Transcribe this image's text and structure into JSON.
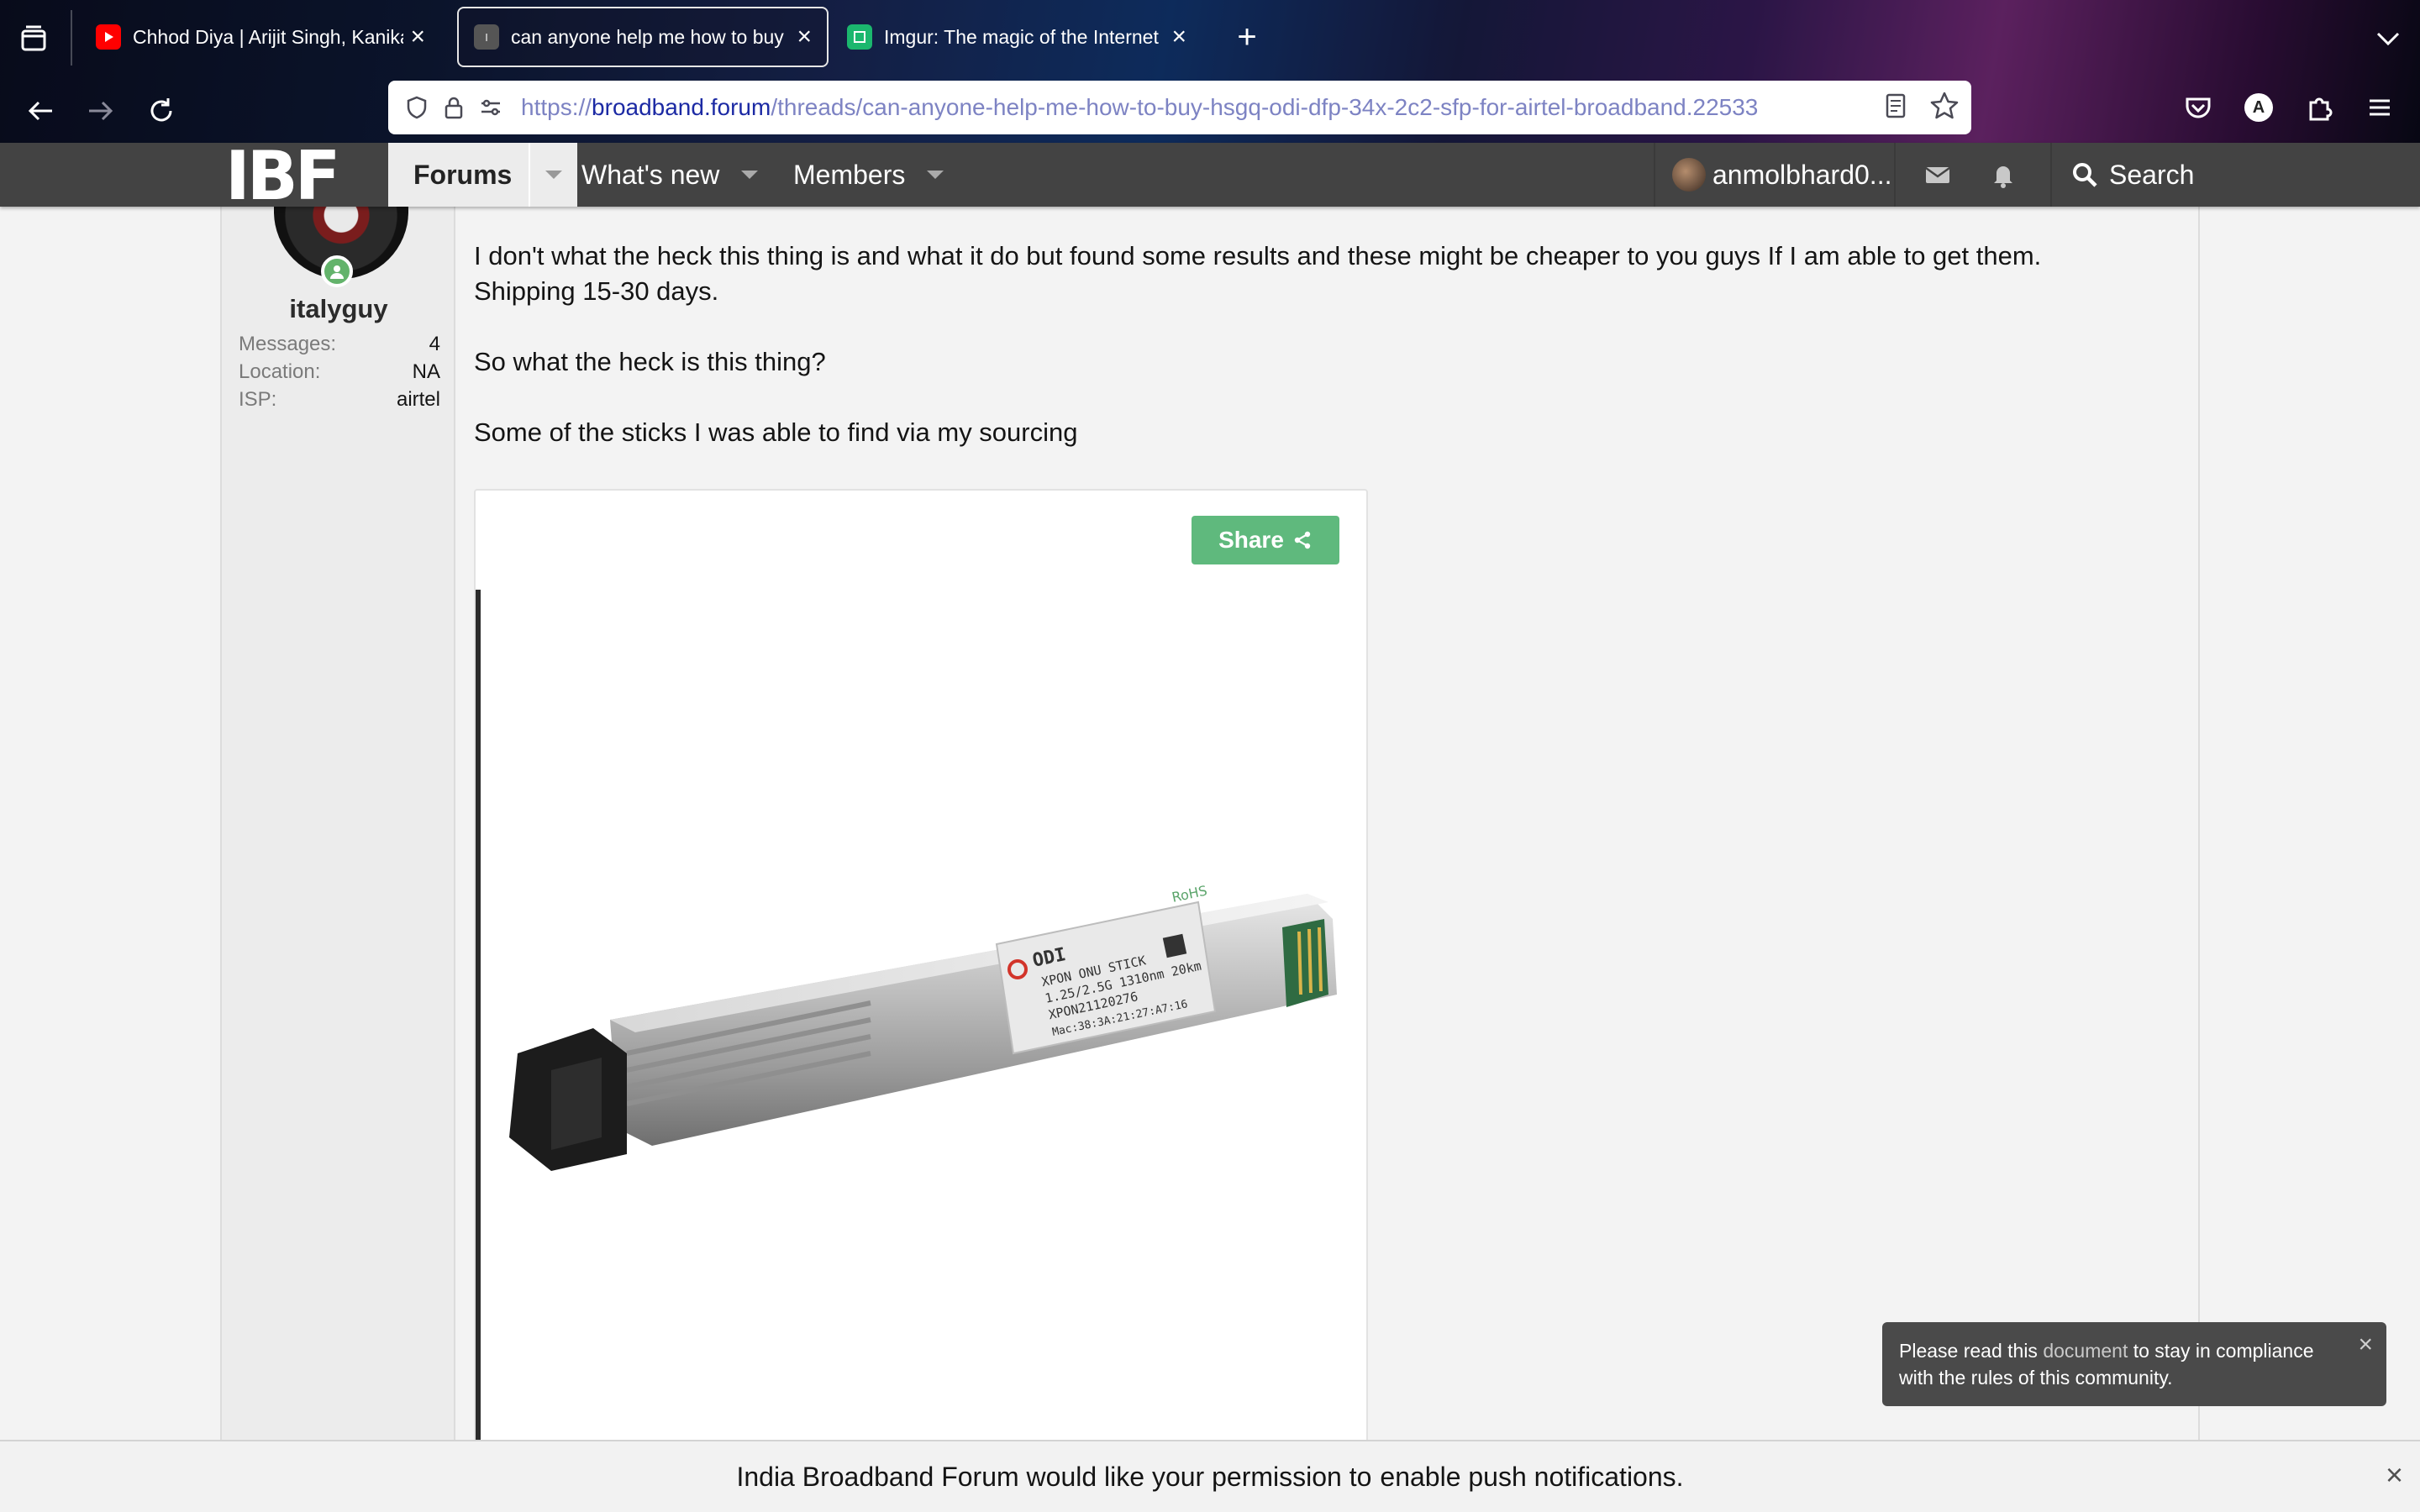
{
  "browser": {
    "tabs": [
      {
        "title": "Chhod Diya | Arijit Singh, Kanika",
        "favicon": "youtube-icon",
        "active": false
      },
      {
        "title": "can anyone help me how to buy",
        "favicon": "ibf-favicon",
        "active": true
      },
      {
        "title": "Imgur: The magic of the Internet",
        "favicon": "imgur-icon",
        "active": false
      }
    ],
    "new_tab": "+",
    "url_scheme": "https://",
    "url_host": "broadband.forum",
    "url_path": "/threads/can-anyone-help-me-how-to-buy-hsgq-odi-dfp-34x-2c2-sfp-for-airtel-broadband.22533",
    "profile_initial": "A"
  },
  "site": {
    "logo": "IBF",
    "nav": [
      {
        "label": "Forums",
        "selected": true
      },
      {
        "label": "What's new",
        "selected": false
      },
      {
        "label": "Members",
        "selected": false
      }
    ],
    "user": "anmolbhard0...",
    "search_label": "Search"
  },
  "post": {
    "author": "italyguy",
    "stats": [
      {
        "key": "Messages:",
        "value": "4"
      },
      {
        "key": "Location:",
        "value": "NA"
      },
      {
        "key": "ISP:",
        "value": "airtel"
      }
    ],
    "paragraphs": [
      "I don't what the heck this thing is and what it do but found some results and these might be cheaper to you guys If I am able to get them.",
      "Shipping 15-30 days.",
      "So what the heck is this thing?",
      "Some of the sticks I was able to find via my sourcing"
    ],
    "share_label": "Share",
    "product_label": {
      "brand": "ODI",
      "line1": "XPON ONU STICK",
      "line2": "1.25/2.5G 1310nm 20km",
      "line3": "XPON21120276",
      "line4": "Mac:38:3A:21:27:A7:16",
      "rohs": "RoHS"
    }
  },
  "toast": {
    "prefix": "Please read this ",
    "link": "document",
    "suffix": " to stay in compliance with the rules of this community.",
    "close": "×"
  },
  "push": {
    "prefix": "India Broadband Forum would like your permission to",
    "link": "enable push notifications.",
    "close": "×"
  },
  "colors": {
    "header_bg": "#434343",
    "share_green": "#5fb97d",
    "online_green": "#63b36b",
    "url_host": "#1c2aa4"
  }
}
